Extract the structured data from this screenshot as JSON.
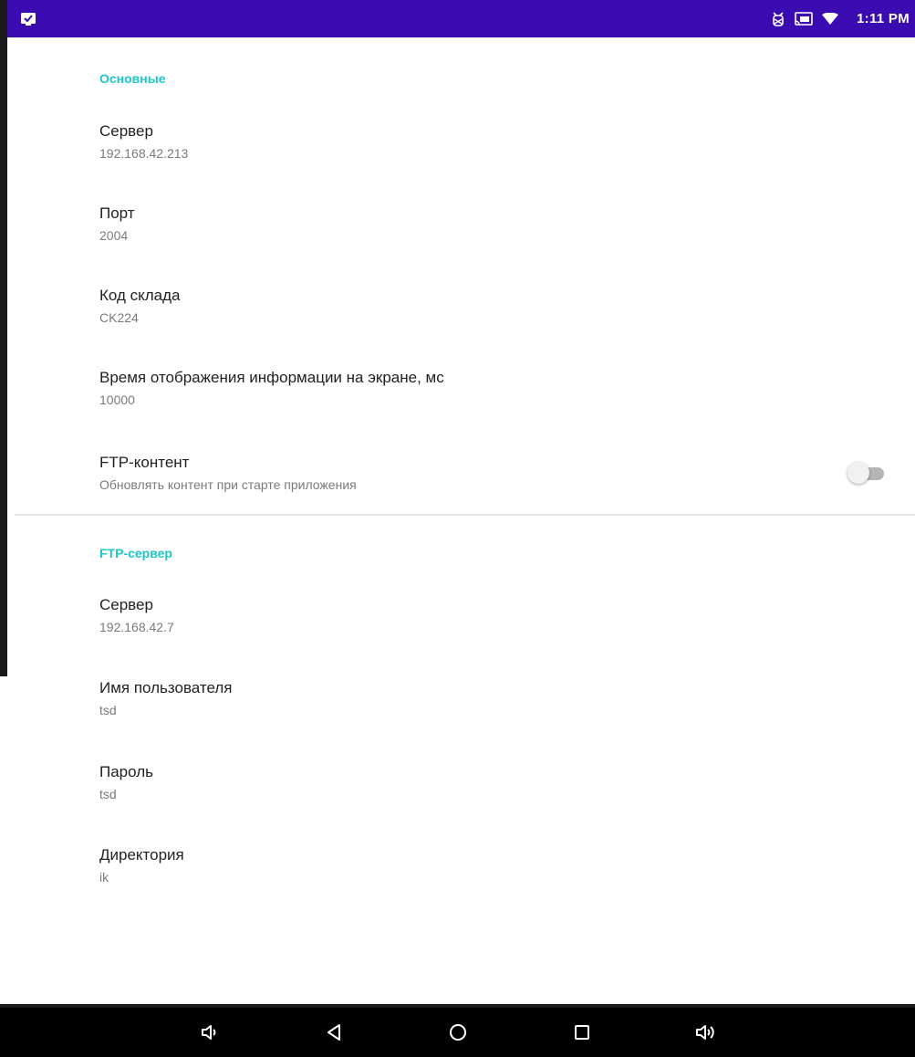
{
  "status_bar": {
    "time": "1:11 PM",
    "bg_color": "#3a0bb0",
    "icons": [
      "app-notification-icon",
      "usb-debug-icon",
      "cast-icon",
      "wifi-icon"
    ]
  },
  "sections": {
    "general": {
      "header": "Основные",
      "server": {
        "title": "Сервер",
        "value": "192.168.42.213"
      },
      "port": {
        "title": "Порт",
        "value": "2004"
      },
      "warehouse": {
        "title": "Код склада",
        "value": "CK224"
      },
      "display_time": {
        "title": "Время отображения информации на экране, мс",
        "value": "10000"
      },
      "ftp_content": {
        "title": "FTP-контент",
        "summary": "Обновлять контент при старте приложения",
        "enabled": false
      }
    },
    "ftp": {
      "header": "FTP-сервер",
      "server": {
        "title": "Сервер",
        "value": "192.168.42.7"
      },
      "username": {
        "title": "Имя пользователя",
        "value": "tsd"
      },
      "password": {
        "title": "Пароль",
        "value": "tsd"
      },
      "directory": {
        "title": "Директория",
        "value": "ik"
      }
    }
  },
  "accent_color": "#1ec7c7",
  "nav_bar": {
    "buttons": [
      "volume-down-icon",
      "back-icon",
      "home-icon",
      "recents-icon",
      "volume-up-icon"
    ]
  }
}
